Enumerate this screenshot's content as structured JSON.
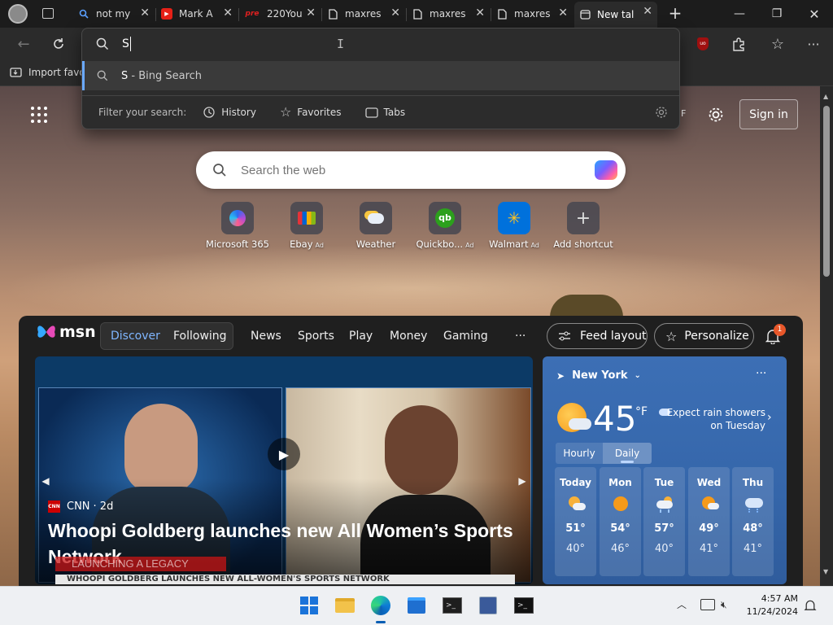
{
  "tabs": [
    {
      "title": "not my",
      "icon": "bing-search-icon"
    },
    {
      "title": "Mark A",
      "icon": "youtube-icon"
    },
    {
      "title": "220You",
      "icon": "pre-icon",
      "icon_text": "pre"
    },
    {
      "title": "maxres",
      "icon": "file-icon"
    },
    {
      "title": "maxres",
      "icon": "file-icon"
    },
    {
      "title": "maxres",
      "icon": "file-icon"
    },
    {
      "title": "New tal",
      "icon": "new-tab-icon",
      "active": true
    }
  ],
  "omnibox": {
    "typed": "S",
    "suggestion_query": "S",
    "suggestion_suffix": " - Bing Search",
    "filter_label": "Filter your search:",
    "filters": [
      "History",
      "Favorites",
      "Tabs"
    ]
  },
  "favorites_bar": {
    "import_label": "Import favor"
  },
  "page": {
    "temp_unit_partial": "F",
    "sign_in": "Sign in",
    "search_placeholder": "Search the web",
    "shortcuts": [
      {
        "label": "Microsoft 365",
        "ad": ""
      },
      {
        "label": "Ebay",
        "ad": "Ad"
      },
      {
        "label": "Weather",
        "ad": ""
      },
      {
        "label": "Quickbo...",
        "ad": "Ad"
      },
      {
        "label": "Walmart",
        "ad": "Ad"
      },
      {
        "label": "Add shortcut",
        "ad": ""
      }
    ]
  },
  "msn": {
    "brand": "msn",
    "tabs": [
      "Discover",
      "Following"
    ],
    "nav": [
      "News",
      "Sports",
      "Play",
      "Money",
      "Gaming"
    ],
    "more": "···",
    "feed_layout": "Feed layout",
    "personalize": "Personalize",
    "notification_count": "1",
    "feature": {
      "source": "CNN",
      "age": "· 2d",
      "headline": "Whoopi Goldberg launches new All Women’s Sports Network",
      "banner": "LAUNCHING A LEGACY",
      "ticker": "WHOOPI GOLDBERG LAUNCHES NEW ALL-WOMEN'S SPORTS NETWORK"
    },
    "weather": {
      "location": "New York",
      "temp": "45",
      "unit": "°F",
      "alert": "Expect rain showers on Tuesday",
      "tab_hourly": "Hourly",
      "tab_daily": "Daily",
      "days": [
        {
          "day": "Today",
          "icon": "partly-cloudy-icon",
          "high": "51°",
          "low": "40°"
        },
        {
          "day": "Mon",
          "icon": "sunny-icon",
          "high": "54°",
          "low": "46°"
        },
        {
          "day": "Tue",
          "icon": "rain-icon",
          "high": "57°",
          "low": "40°"
        },
        {
          "day": "Wed",
          "icon": "partly-cloudy-icon",
          "high": "49°",
          "low": "41°"
        },
        {
          "day": "Thu",
          "icon": "rain-icon",
          "high": "48°",
          "low": "41°"
        }
      ]
    }
  },
  "taskbar": {
    "time": "4:57 AM",
    "date": "11/24/2024"
  },
  "colors": {
    "accent": "#6aa9ff",
    "msn_bg": "#1f1f1f",
    "weather_bg": "#3566aa"
  }
}
